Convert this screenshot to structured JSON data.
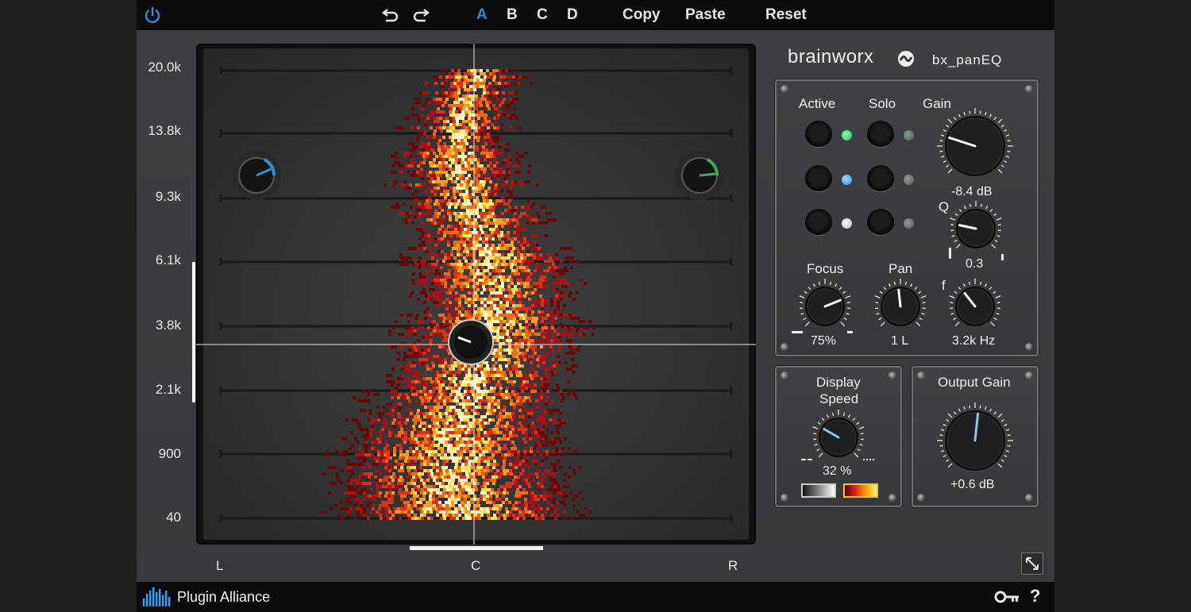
{
  "topbar": {
    "undo_icon": "undo-icon",
    "redo_icon": "redo-icon",
    "presets": [
      "A",
      "B",
      "C",
      "D"
    ],
    "selected_preset": "A",
    "copy_label": "Copy",
    "paste_label": "Paste",
    "reset_label": "Reset",
    "accent_color": "#2c8fd8"
  },
  "display": {
    "freq_labels": [
      "20.0k",
      "13.8k",
      "9.3k",
      "6.1k",
      "3.8k",
      "2.1k",
      "900",
      "40"
    ],
    "pan_labels": {
      "left": "L",
      "center": "C",
      "right": "R"
    }
  },
  "brand": {
    "name": "brainworx",
    "product": "bx_panEQ"
  },
  "band_panel": {
    "active_label": "Active",
    "solo_label": "Solo",
    "gain_label": "Gain",
    "gain_value": "-8.4 dB",
    "q_label": "Q",
    "q_value": "0.3",
    "focus_label": "Focus",
    "focus_value": "75%",
    "pan_label": "Pan",
    "pan_value": "1 L",
    "f_label": "f",
    "f_value": "3.2k Hz",
    "led_colors": [
      "#3fd67a",
      "#3aa0ef",
      "#d8d8d8"
    ]
  },
  "display_speed": {
    "label_line1": "Display",
    "label_line2": "Speed",
    "value": "32 %"
  },
  "output_gain": {
    "label": "Output Gain",
    "value": "+0.6 dB"
  },
  "statusbar": {
    "company": "Plugin Alliance",
    "help": "?",
    "key_icon": "key-icon"
  }
}
